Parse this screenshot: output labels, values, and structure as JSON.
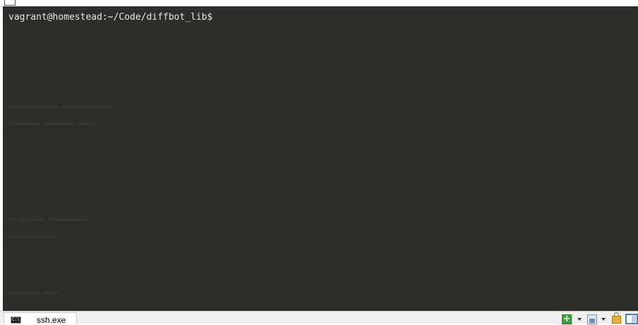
{
  "terminal": {
    "prompt": "vagrant@homestead:~/Code/diffbot_lib$",
    "background_color": "#2d2d29",
    "text_color": "#e9e9e2"
  },
  "statusbar": {
    "tab_label": "ssh.exe",
    "tab_icon_text": "C:\\_"
  }
}
